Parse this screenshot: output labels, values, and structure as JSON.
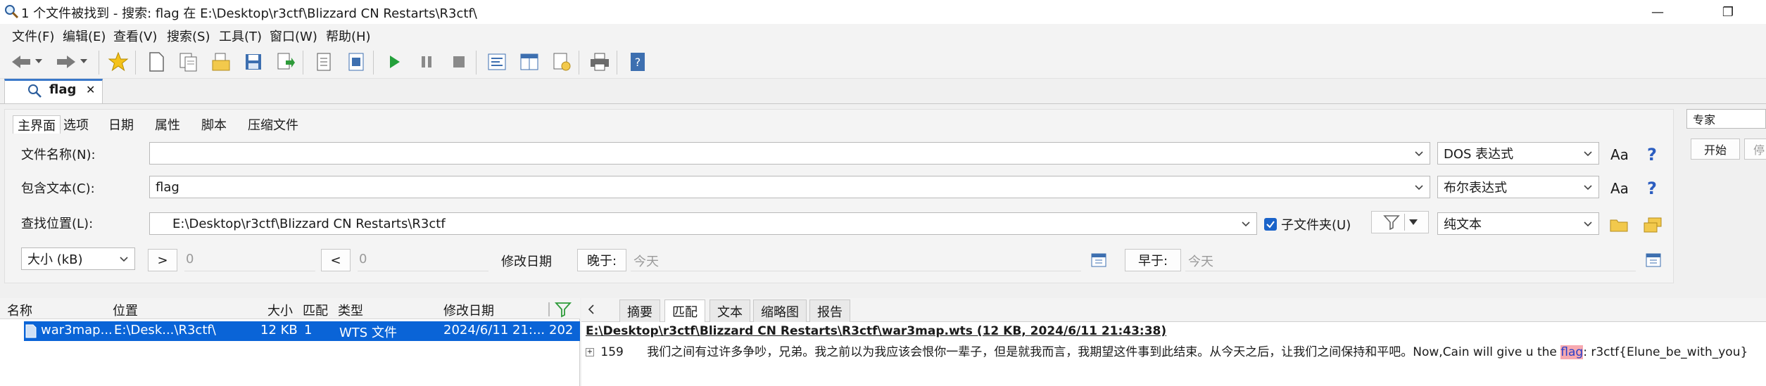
{
  "window": {
    "title": "1 个文件被找到 - 搜索: flag 在 E:\\Desktop\\r3ctf\\Blizzard CN Restarts\\R3ctf\\",
    "minimize_glyph": "—",
    "restore_glyph": "❐"
  },
  "menu": [
    "文件(F)",
    "编辑(E)",
    "查看(V)",
    "搜索(S)",
    "工具(T)",
    "窗口(W)",
    "帮助(H)"
  ],
  "toolbar_icons": [
    "back-icon",
    "forward-icon",
    "favorite-star-icon",
    "new-document-icon",
    "copy-document-icon",
    "open-folder-icon",
    "save-icon",
    "export-icon",
    "report-icon",
    "save-report-icon",
    "start-icon",
    "pause-icon",
    "stop-icon",
    "wrap-icon",
    "layout-icon",
    "settings-icon",
    "print-icon",
    "help-icon"
  ],
  "doc_tab": {
    "label": "flag",
    "close": "✕"
  },
  "panel_tabs": [
    "主界面",
    "选项",
    "日期",
    "属性",
    "脚本",
    "压缩文件"
  ],
  "search": {
    "filename_label": "文件名称(N):",
    "filename_value": "",
    "filename_mode": "DOS 表达式",
    "contains_label": "包含文本(C):",
    "contains_value": "flag",
    "contains_mode": "布尔表达式",
    "location_label": "查找位置(L):",
    "location_value": "E:\\Desktop\\r3ctf\\Blizzard CN Restarts\\R3ctf",
    "subfolders_label": "子文件夹(U)",
    "subfolders_checked": true,
    "text_mode": "纯文本",
    "aa_label": "Aa",
    "help_glyph": "?",
    "size_label": "大小 (kB)",
    "gt_symbol": ">",
    "gt_value": "0",
    "lt_symbol": "<",
    "lt_value": "0",
    "date_label": "修改日期",
    "later_button": "晚于:",
    "later_value": "今天",
    "earlier_button": "早于:",
    "earlier_value": "今天"
  },
  "right_panel": {
    "mode": "专家",
    "start_button": "开始",
    "stop_button": "停"
  },
  "results": {
    "columns": [
      "名称",
      "位置",
      "大小",
      "匹配",
      "类型",
      "修改日期"
    ],
    "rows": [
      {
        "name": "war3map...",
        "location": "E:\\Desk...\\R3ctf\\",
        "size": "12 KB",
        "matches": "1",
        "type": "WTS 文件",
        "modified": "2024/6/11 21:...",
        "extra": "202"
      }
    ]
  },
  "preview": {
    "tabs": [
      "摘要",
      "匹配",
      "文本",
      "缩略图",
      "报告"
    ],
    "active_tab": "匹配",
    "file_header": "E:\\Desktop\\r3ctf\\Blizzard CN Restarts\\R3ctf\\war3map.wts   (12 KB,  2024/6/11 21:43:38)",
    "line_number": "159",
    "line_before": "我们之间有过许多争吵，兄弟。我之前以为我应该会恨你一辈子，但是就我而言，我期望这件事到此结束。从今天之后，让我们之间保持和平吧。Now,Cain will give u the ",
    "line_match": "flag",
    "line_after": ": r3ctf{Elune_be_with_you}"
  },
  "colors": {
    "selection": "#0a64d7",
    "accent": "#3a78c9",
    "highlight": "#f7a9b0",
    "link": "#2a40c8"
  }
}
